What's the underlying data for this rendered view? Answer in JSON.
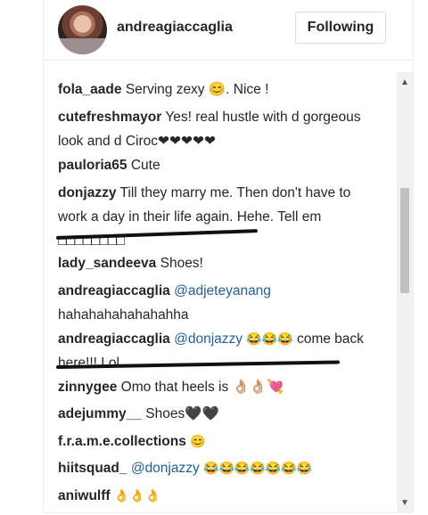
{
  "header": {
    "username": "andreagiaccaglia",
    "follow_label": "Following"
  },
  "comments": [
    {
      "user": "fola_aade",
      "text": "Serving zexy 😊. Nice !"
    },
    {
      "user": "cutefreshmayor",
      "text": "Yes! real hustle with d gorgeous look and d Ciroc❤❤❤❤❤"
    },
    {
      "user": "pauloria65",
      "text": "Cute"
    },
    {
      "user": "donjazzy",
      "text": "Till they marry me. Then don't have to work a day in their life again. Hehe. Tell em □□□□□□□□"
    },
    {
      "user": "lady_sandeeva",
      "text": "Shoes!"
    },
    {
      "user": "andreagiaccaglia",
      "mention": "@adjeteyanang",
      "text": "hahahahahahahahha"
    },
    {
      "user": "andreagiaccaglia",
      "mention": "@donjazzy",
      "emoji": "😂😂😂",
      "text": "come back here!!! Lol"
    },
    {
      "user": "zinnygee",
      "text": "Omo that heels is 👌🏼👌🏼💘"
    },
    {
      "user": "adejummy__",
      "text": "Shoes🖤🖤"
    },
    {
      "user": "f.r.a.m.e.collections",
      "text": "😊"
    },
    {
      "user": "hiitsquad_",
      "mention": "@donjazzy",
      "text": "😂😂😂😂😂😂😂"
    },
    {
      "user": "aniwulff",
      "text": "👌👌👌"
    }
  ],
  "colors": {
    "mention": "#1f5f9e",
    "heart": "#c00000",
    "scroll_thumb": "#c1c1c1",
    "ink": "#111111"
  },
  "icons": {
    "scroll_up": "▲",
    "scroll_down": "▼"
  }
}
